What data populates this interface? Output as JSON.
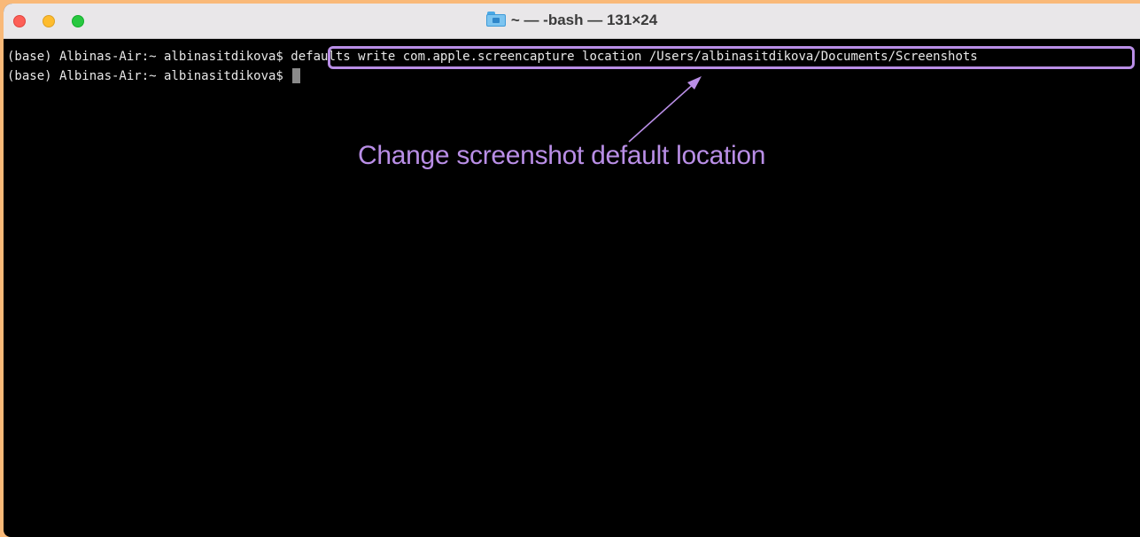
{
  "window": {
    "title": "~ — -bash — 131×24",
    "title_icon": "home-folder-icon"
  },
  "terminal": {
    "lines": [
      {
        "prompt": "(base) Albinas-Air:~ albinasitdikova$ ",
        "command": "defaults write com.apple.screencapture location /Users/albinasitdikova/Documents/Screenshots"
      },
      {
        "prompt": "(base) Albinas-Air:~ albinasitdikova$ ",
        "command": ""
      }
    ]
  },
  "annotation": {
    "text": "Change screenshot default location",
    "color": "#b98ee6"
  },
  "colors": {
    "background": "#f9b978",
    "terminal_bg": "#000000",
    "terminal_text": "#e8e8e8",
    "titlebar": "#e9e7e9",
    "close": "#fd5f57",
    "minimize": "#febc2e",
    "zoom": "#28c840"
  }
}
